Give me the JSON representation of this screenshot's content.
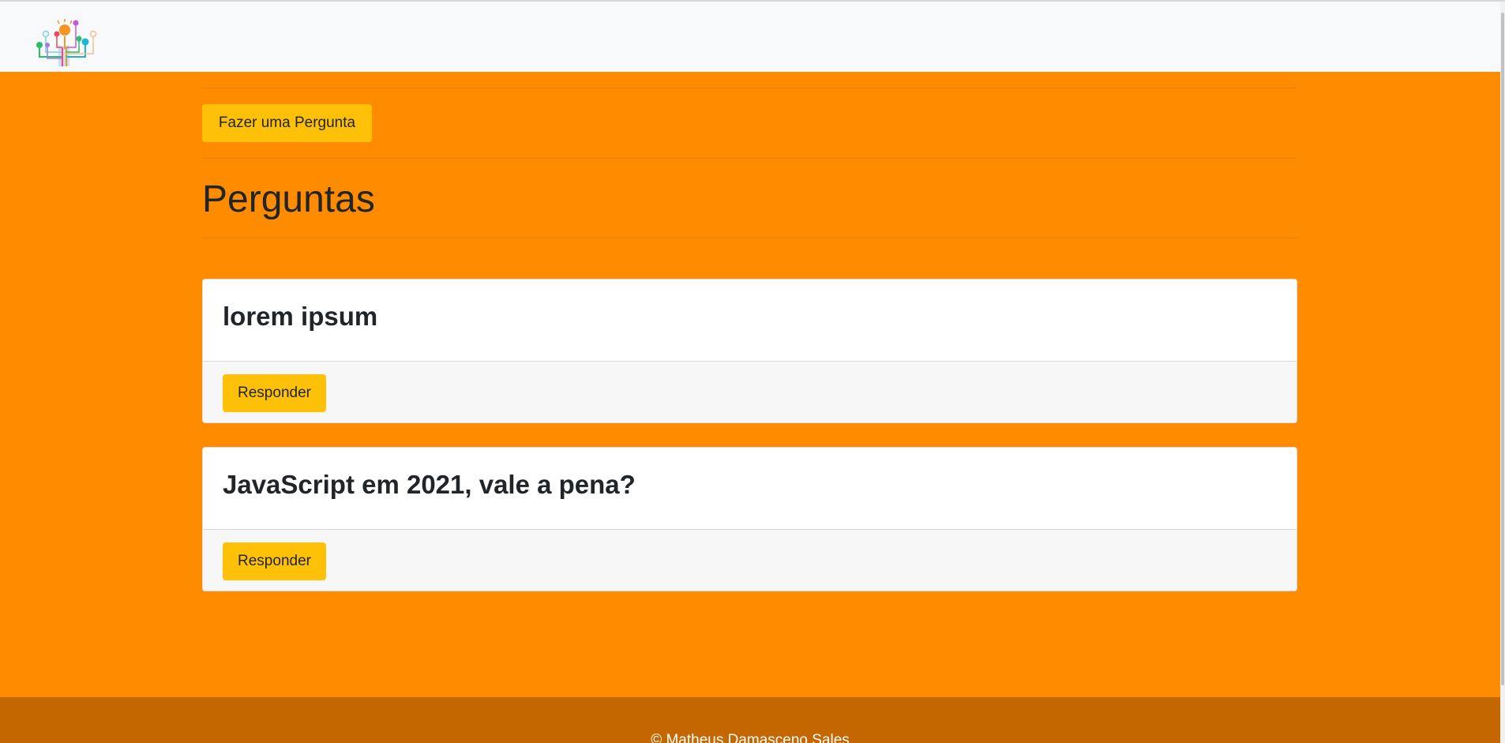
{
  "navbar": {
    "logo_icon": "lightbulb-tree-logo"
  },
  "actions": {
    "ask_button_label": "Fazer uma Pergunta"
  },
  "page": {
    "title": "Perguntas"
  },
  "questions": [
    {
      "title": "lorem ipsum",
      "answer_button_label": "Responder"
    },
    {
      "title": "JavaScript em 2021, vale a pena?",
      "answer_button_label": "Responder"
    }
  ],
  "footer": {
    "text": "© Matheus Damasceno Sales"
  },
  "colors": {
    "background": "#ff8c00",
    "navbar": "#f8f9fa",
    "button": "#ffc107",
    "footer": "#c46700",
    "text": "#212529"
  }
}
